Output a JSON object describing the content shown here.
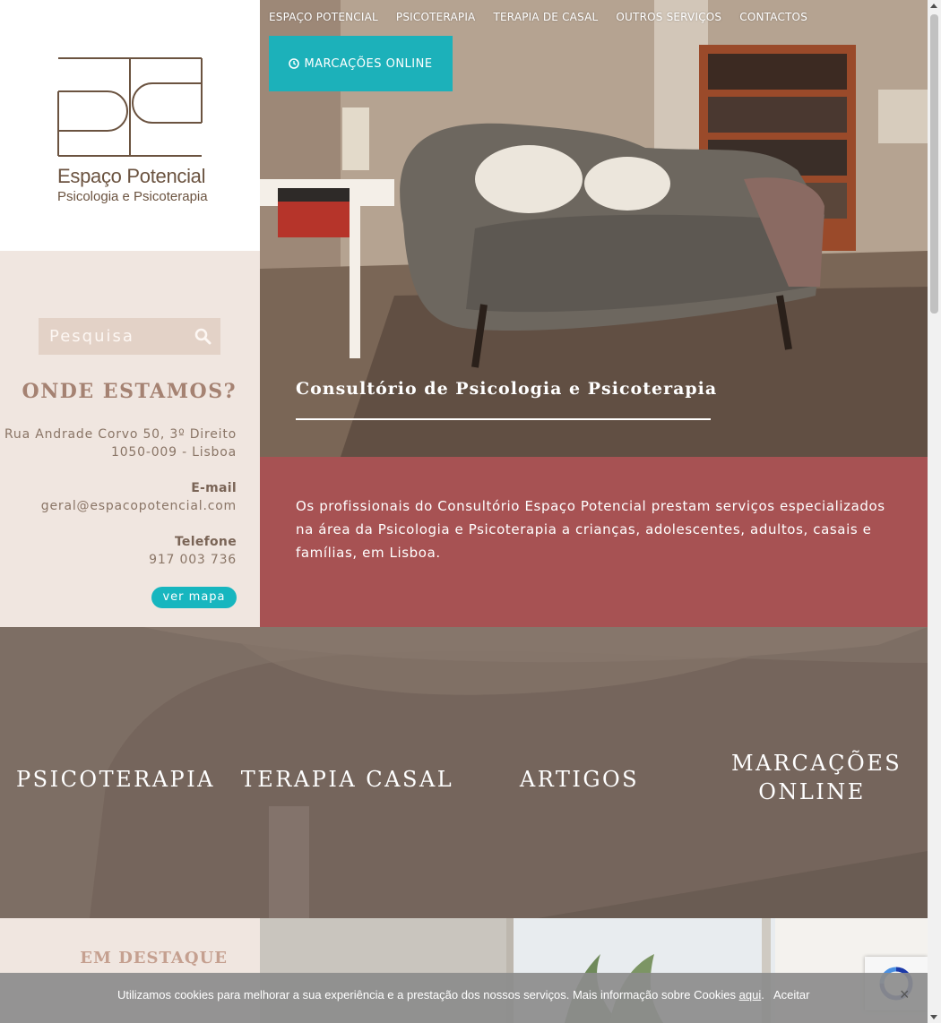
{
  "logo": {
    "name": "Espaço Potencial",
    "subtitle": "Psicologia e Psicoterapia"
  },
  "search": {
    "placeholder": "Pesquisa"
  },
  "contact": {
    "heading": "ONDE ESTAMOS?",
    "address_line1": "Rua Andrade Corvo 50, 3º Direito",
    "address_line2": "1050-009 - Lisboa",
    "email_label": "E-mail",
    "email": "geral@espacopotencial.com",
    "phone_label": "Telefone",
    "phone": "917 003 736",
    "map_button": "ver mapa"
  },
  "nav": {
    "items": [
      "ESPAÇO POTENCIAL",
      "PSICOTERAPIA",
      "TERAPIA DE CASAL",
      "OUTROS SERVIÇOS",
      "CONTACTOS"
    ],
    "booking": "MARCAÇÕES ONLINE"
  },
  "hero": {
    "title": "Consultório de Psicologia e Psicoterapia"
  },
  "intro": {
    "text": "Os profissionais do Consultório Espaço Potencial prestam serviços especializados na área da Psicologia e Psicoterapia a crianças, adolescentes, adultos, casais e famílias, em Lisboa."
  },
  "categories": [
    {
      "label": "PSICOTERAPIA"
    },
    {
      "label": "TERAPIA CASAL"
    },
    {
      "label": "ARTIGOS"
    },
    {
      "label": "MARCAÇÕES ONLINE"
    }
  ],
  "featured": {
    "title": "EM DESTAQUE"
  },
  "cookie": {
    "text": "Utilizamos cookies para melhorar a sua experiência e a prestação dos nossos serviços. Mais informação sobre Cookies ",
    "link": "aqui",
    "accept": "Aceitar",
    "close": "×"
  },
  "colors": {
    "teal": "#1cb1ba",
    "burgundy": "#a75253",
    "sand": "#f0e6e0",
    "brown": "#6b5340"
  }
}
